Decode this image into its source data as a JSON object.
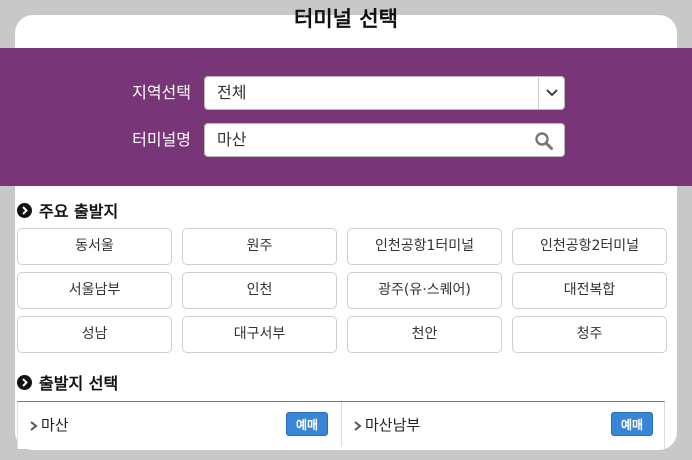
{
  "title": "터미널 선택",
  "filters": {
    "region_label": "지역선택",
    "region_value": "전체",
    "terminal_label": "터미널명",
    "terminal_value": "마산"
  },
  "major_departures": {
    "heading": "주요 출발지",
    "items": [
      "동서울",
      "원주",
      "인천공항1터미널",
      "인천공항2터미널",
      "서울남부",
      "인천",
      "광주(유·스퀘어)",
      "대전복합",
      "성남",
      "대구서부",
      "천안",
      "청주"
    ]
  },
  "departure_select": {
    "heading": "출발지 선택",
    "results": [
      {
        "name": "마산",
        "button": "예매"
      },
      {
        "name": "마산남부",
        "button": "예매"
      }
    ]
  },
  "colors": {
    "band": "#783678",
    "reserve_button": "#3a86d6",
    "page_bg": "#c8c8c8"
  },
  "icons": {
    "select_arrow": "chevron-down-icon",
    "search": "search-icon",
    "section_bullet": "circle-chevron-right-icon",
    "result_arrow": "chevron-right-icon"
  }
}
